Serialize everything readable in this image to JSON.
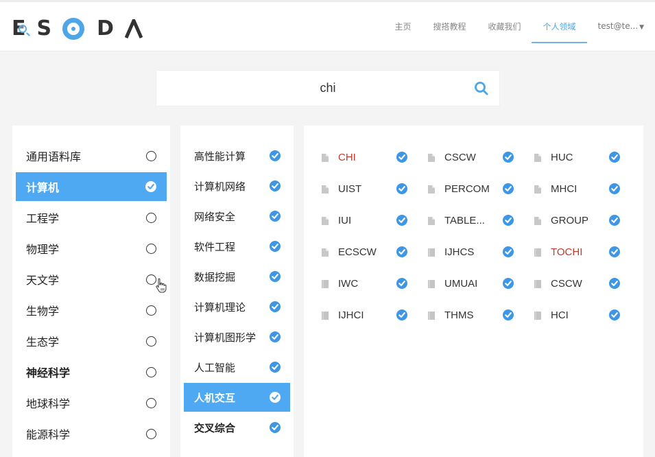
{
  "header": {
    "logo_letters": [
      "E",
      "S",
      "O",
      "D",
      "A"
    ],
    "logo_text": "ESODA",
    "nav": [
      {
        "label": "主页",
        "active": false
      },
      {
        "label": "搜搭教程",
        "active": false
      },
      {
        "label": "收藏我们",
        "active": false
      },
      {
        "label": "个人领域",
        "active": true
      }
    ],
    "user": {
      "label": "test@te...",
      "icon": "caret-down-icon"
    },
    "accent_color": "#4da6e8"
  },
  "search": {
    "value": "chi",
    "placeholder": "",
    "button_icon": "search-icon"
  },
  "disciplines": [
    {
      "label": "通用语料库",
      "selected": false,
      "bold": false
    },
    {
      "label": "计算机",
      "selected": true,
      "bold": true
    },
    {
      "label": "工程学",
      "selected": false,
      "bold": false
    },
    {
      "label": "物理学",
      "selected": false,
      "bold": false
    },
    {
      "label": "天文学",
      "selected": false,
      "bold": false
    },
    {
      "label": "生物学",
      "selected": false,
      "bold": false
    },
    {
      "label": "生态学",
      "selected": false,
      "bold": false
    },
    {
      "label": "神经科学",
      "selected": false,
      "bold": true
    },
    {
      "label": "地球科学",
      "selected": false,
      "bold": false
    },
    {
      "label": "能源科学",
      "selected": false,
      "bold": false
    }
  ],
  "subfields": [
    {
      "label": "高性能计算",
      "checked": true,
      "selected": false,
      "bold": false
    },
    {
      "label": "计算机网络",
      "checked": true,
      "selected": false,
      "bold": false
    },
    {
      "label": "网络安全",
      "checked": true,
      "selected": false,
      "bold": false
    },
    {
      "label": "软件工程",
      "checked": true,
      "selected": false,
      "bold": false
    },
    {
      "label": "数据挖掘",
      "checked": true,
      "selected": false,
      "bold": false
    },
    {
      "label": "计算机理论",
      "checked": true,
      "selected": false,
      "bold": false
    },
    {
      "label": "计算机图形学",
      "checked": true,
      "selected": false,
      "bold": false
    },
    {
      "label": "人工智能",
      "checked": true,
      "selected": false,
      "bold": false
    },
    {
      "label": "人机交互",
      "checked": true,
      "selected": true,
      "bold": true
    },
    {
      "label": "交叉综合",
      "checked": true,
      "selected": false,
      "bold": true
    }
  ],
  "venues": [
    {
      "name": "CHI",
      "type": "conference",
      "highlight": true,
      "checked": true
    },
    {
      "name": "CSCW",
      "type": "conference",
      "highlight": false,
      "checked": true
    },
    {
      "name": "HUC",
      "type": "conference",
      "highlight": false,
      "checked": true
    },
    {
      "name": "UIST",
      "type": "conference",
      "highlight": false,
      "checked": true
    },
    {
      "name": "PERCOM",
      "type": "conference",
      "highlight": false,
      "checked": true
    },
    {
      "name": "MHCI",
      "type": "conference",
      "highlight": false,
      "checked": true
    },
    {
      "name": "IUI",
      "type": "conference",
      "highlight": false,
      "checked": true
    },
    {
      "name": "TABLE...",
      "type": "conference",
      "highlight": false,
      "checked": true
    },
    {
      "name": "GROUP",
      "type": "conference",
      "highlight": false,
      "checked": true
    },
    {
      "name": "ECSCW",
      "type": "conference",
      "highlight": false,
      "checked": true
    },
    {
      "name": "IJHCS",
      "type": "journal",
      "highlight": false,
      "checked": true
    },
    {
      "name": "TOCHI",
      "type": "journal",
      "highlight": true,
      "checked": true
    },
    {
      "name": "IWC",
      "type": "journal",
      "highlight": false,
      "checked": true
    },
    {
      "name": "UMUAI",
      "type": "journal",
      "highlight": false,
      "checked": true
    },
    {
      "name": "CSCW",
      "type": "journal",
      "highlight": false,
      "checked": true
    },
    {
      "name": "IJHCI",
      "type": "journal",
      "highlight": false,
      "checked": true
    },
    {
      "name": "THMS",
      "type": "journal",
      "highlight": false,
      "checked": true
    },
    {
      "name": "HCI",
      "type": "journal",
      "highlight": false,
      "checked": true
    }
  ],
  "colors": {
    "selected_bg": "#4ea9f2",
    "check_blue": "#3d96e6",
    "highlight_red": "#c0392b"
  }
}
